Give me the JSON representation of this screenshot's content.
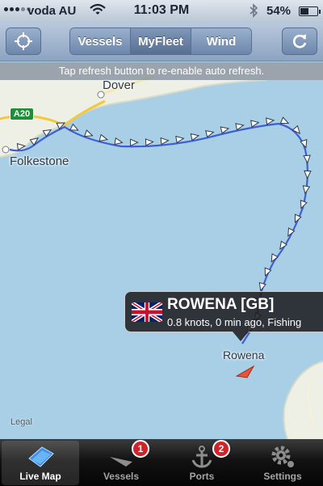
{
  "status_bar": {
    "carrier": "voda AU",
    "time": "11:03 PM",
    "battery": "54%",
    "battery_level": 0.54
  },
  "nav": {
    "segments": [
      "Vessels",
      "MyFleet",
      "Wind"
    ],
    "active_segment": 1
  },
  "notice": "Tap refresh button to re-enable auto refresh.",
  "map": {
    "places": {
      "dover": "Dover",
      "folkestone": "Folkestone",
      "rowena": "Rowena"
    },
    "road": "A20",
    "legal": "Legal",
    "colors": {
      "sea": "#a9cfe6",
      "land": "#eef0e6",
      "track": "#3d5fd4",
      "vessel": "#e8543a"
    }
  },
  "callout": {
    "name": "ROWENA [GB]",
    "detail": "0.8 knots, 0 min ago, Fishing",
    "flag": "uk-flag-icon"
  },
  "tabs": [
    {
      "label": "Live Map",
      "icon": "map-icon",
      "active": true
    },
    {
      "label": "Vessels",
      "icon": "vessel-icon",
      "badge": "1"
    },
    {
      "label": "Ports",
      "icon": "anchor-icon",
      "badge": "2"
    },
    {
      "label": "Settings",
      "icon": "gear-icon"
    }
  ]
}
